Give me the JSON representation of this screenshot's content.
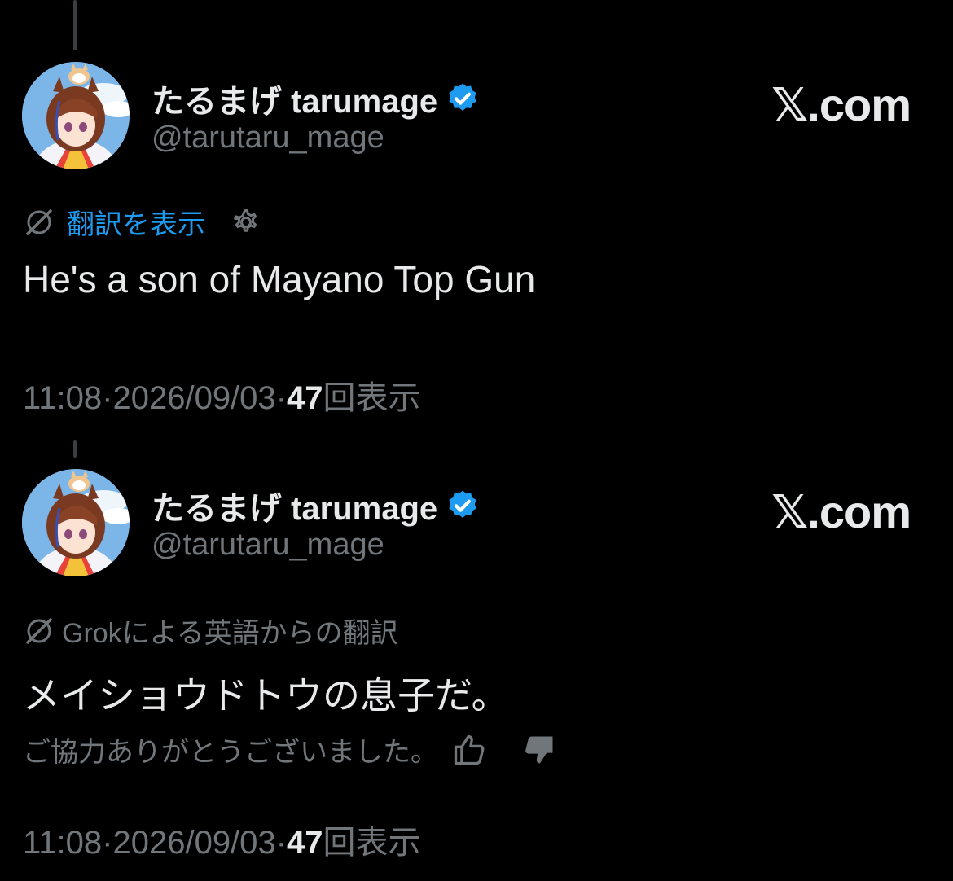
{
  "tweets": [
    {
      "display_name": "たるまげ tarumage",
      "handle": "@tarutaru_mage",
      "brand": "𝕏.com",
      "translate_link": "翻訳を表示",
      "body": "He's a son of Mayano Top Gun",
      "time": "11:08",
      "sep1": " · ",
      "date": "2026/09/03",
      "sep2": " · ",
      "views_count": "47",
      "views_label": "回表示"
    },
    {
      "display_name": "たるまげ tarumage",
      "handle": "@tarutaru_mage",
      "brand": "𝕏.com",
      "translated_by": "Grokによる英語からの翻訳",
      "body": "メイショウドトウの息子だ。",
      "feedback": "ご協力ありがとうございました。",
      "time": "11:08",
      "sep1": " · ",
      "date": "2026/09/03",
      "sep2": " · ",
      "views_count": "47",
      "views_label": "回表示"
    }
  ],
  "colors": {
    "background": "#000000",
    "primary_text": "#e7e9ea",
    "secondary_text": "#71767b",
    "link": "#1d9bf0",
    "verified": "#1d9bf0"
  },
  "icons": [
    "verified-badge-icon",
    "grok-translate-icon",
    "gear-icon",
    "thumbs-up-icon",
    "thumbs-down-icon"
  ]
}
